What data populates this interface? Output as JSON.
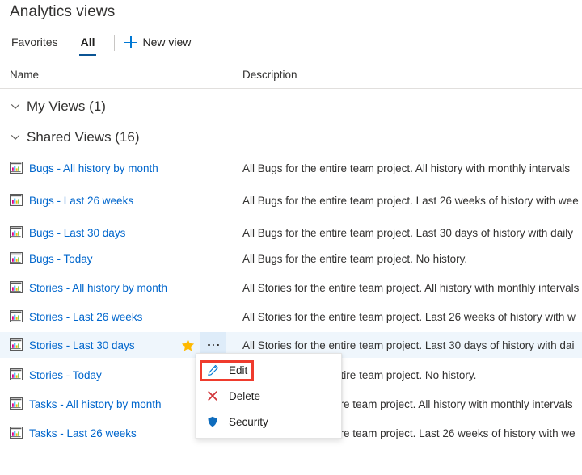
{
  "page": {
    "title": "Analytics views"
  },
  "tabs": [
    {
      "label": "Favorites",
      "active": false,
      "name": "tab-favorites"
    },
    {
      "label": "All",
      "active": true,
      "name": "tab-all"
    }
  ],
  "commandbar": {
    "new_view_label": "New view",
    "new_view_icon": "plus-icon"
  },
  "columns": {
    "name": "Name",
    "description": "Description"
  },
  "groups": [
    {
      "label": "My Views (1)",
      "expanded": true,
      "icon": "chevron-down-icon"
    },
    {
      "label": "Shared Views (16)",
      "expanded": true,
      "icon": "chevron-down-icon"
    }
  ],
  "rows": [
    {
      "name": "Bugs - All history by month",
      "description": "All Bugs for the entire team project. All history with monthly intervals",
      "icon": "chart-report-icon",
      "selected": false,
      "favorite": false
    },
    {
      "name": "Bugs - Last 26 weeks",
      "description": "All Bugs for the entire team project. Last 26 weeks of history with wee",
      "icon": "chart-report-icon",
      "selected": false,
      "favorite": false
    },
    {
      "name": "Bugs - Last 30 days",
      "description": "All Bugs for the entire team project. Last 30 days of history with daily",
      "icon": "chart-report-icon",
      "selected": false,
      "favorite": false
    },
    {
      "name": "Bugs - Today",
      "description": "All Bugs for the entire team project. No history.",
      "icon": "chart-report-icon",
      "selected": false,
      "favorite": false
    },
    {
      "name": "Stories - All history by month",
      "description": "All Stories for the entire team project. All history with monthly intervals",
      "icon": "chart-report-icon",
      "selected": false,
      "favorite": false
    },
    {
      "name": "Stories - Last 26 weeks",
      "description": "All Stories for the entire team project. Last 26 weeks of history with w",
      "icon": "chart-report-icon",
      "selected": false,
      "favorite": false
    },
    {
      "name": "Stories - Last 30 days",
      "description": "All Stories for the entire team project. Last 30 days of history with dai",
      "icon": "chart-report-icon",
      "selected": true,
      "favorite": true
    },
    {
      "name": "Stories - Today",
      "description": "All Stories for the entire team project. No history.",
      "icon": "chart-report-icon",
      "selected": false,
      "favorite": false
    },
    {
      "name": "Tasks - All history by month",
      "description": "All Tasks for the entire team project. All history with monthly intervals",
      "icon": "chart-report-icon",
      "selected": false,
      "favorite": false
    },
    {
      "name": "Tasks - Last 26 weeks",
      "description": "All Tasks for the entire team project. Last 26 weeks of history with we",
      "icon": "chart-report-icon",
      "selected": false,
      "favorite": false
    }
  ],
  "context_menu": {
    "items": [
      {
        "label": "Edit",
        "icon": "pencil-icon",
        "highlighted": true
      },
      {
        "label": "Delete",
        "icon": "x-close-icon",
        "highlighted": false
      },
      {
        "label": "Security",
        "icon": "shield-icon",
        "highlighted": false
      }
    ]
  },
  "colors": {
    "link": "#0066cc",
    "accent": "#0078d4",
    "tab_underline": "#0b5494",
    "selected_row_bg": "#eff6fc",
    "more_button_bg": "#deecf9",
    "star": "#ffb900",
    "delete_icon": "#d13438",
    "annotation": "#ef3b2d",
    "text": "#323130"
  }
}
